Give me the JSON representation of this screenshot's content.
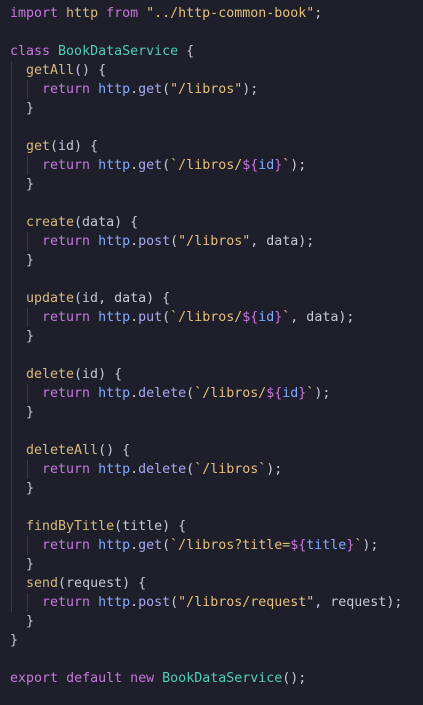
{
  "code": {
    "language": "javascript",
    "lines": [
      [
        {
          "t": "import",
          "c": "kw"
        },
        {
          "t": " http ",
          "c": "fnname"
        },
        {
          "t": "from",
          "c": "kw"
        },
        {
          "t": " ",
          "c": "punc"
        },
        {
          "t": "\"../http-common-book\"",
          "c": "str"
        },
        {
          "t": ";",
          "c": "punc"
        }
      ],
      [],
      [
        {
          "t": "class",
          "c": "kw"
        },
        {
          "t": " ",
          "c": "punc"
        },
        {
          "t": "BookDataService",
          "c": "cls"
        },
        {
          "t": " {",
          "c": "punc"
        }
      ],
      [
        {
          "t": "  getAll",
          "c": "fnname"
        },
        {
          "t": "() {",
          "c": "punc"
        }
      ],
      [
        {
          "t": "    ",
          "c": "punc"
        },
        {
          "t": "return",
          "c": "kw"
        },
        {
          "t": " http",
          "c": "var"
        },
        {
          "t": ".",
          "c": "punc"
        },
        {
          "t": "get",
          "c": "fn"
        },
        {
          "t": "(",
          "c": "punc"
        },
        {
          "t": "\"/libros\"",
          "c": "str"
        },
        {
          "t": ");",
          "c": "punc"
        }
      ],
      [
        {
          "t": "  }",
          "c": "punc"
        }
      ],
      [],
      [
        {
          "t": "  get",
          "c": "fnname"
        },
        {
          "t": "(id) {",
          "c": "punc"
        }
      ],
      [
        {
          "t": "    ",
          "c": "punc"
        },
        {
          "t": "return",
          "c": "kw"
        },
        {
          "t": " http",
          "c": "var"
        },
        {
          "t": ".",
          "c": "punc"
        },
        {
          "t": "get",
          "c": "fn"
        },
        {
          "t": "(",
          "c": "punc"
        },
        {
          "t": "`/libros/",
          "c": "tpl"
        },
        {
          "t": "${",
          "c": "kw"
        },
        {
          "t": "id",
          "c": "var"
        },
        {
          "t": "}",
          "c": "kw"
        },
        {
          "t": "`",
          "c": "tpl"
        },
        {
          "t": ");",
          "c": "punc"
        }
      ],
      [
        {
          "t": "  }",
          "c": "punc"
        }
      ],
      [],
      [
        {
          "t": "  create",
          "c": "fnname"
        },
        {
          "t": "(data) {",
          "c": "punc"
        }
      ],
      [
        {
          "t": "    ",
          "c": "punc"
        },
        {
          "t": "return",
          "c": "kw"
        },
        {
          "t": " http",
          "c": "var"
        },
        {
          "t": ".",
          "c": "punc"
        },
        {
          "t": "post",
          "c": "fn"
        },
        {
          "t": "(",
          "c": "punc"
        },
        {
          "t": "\"/libros\"",
          "c": "str"
        },
        {
          "t": ", data);",
          "c": "punc"
        }
      ],
      [
        {
          "t": "  }",
          "c": "punc"
        }
      ],
      [],
      [
        {
          "t": "  update",
          "c": "fnname"
        },
        {
          "t": "(id, data) {",
          "c": "punc"
        }
      ],
      [
        {
          "t": "    ",
          "c": "punc"
        },
        {
          "t": "return",
          "c": "kw"
        },
        {
          "t": " http",
          "c": "var"
        },
        {
          "t": ".",
          "c": "punc"
        },
        {
          "t": "put",
          "c": "fn"
        },
        {
          "t": "(",
          "c": "punc"
        },
        {
          "t": "`/libros/",
          "c": "tpl"
        },
        {
          "t": "${",
          "c": "kw"
        },
        {
          "t": "id",
          "c": "var"
        },
        {
          "t": "}",
          "c": "kw"
        },
        {
          "t": "`",
          "c": "tpl"
        },
        {
          "t": ", data);",
          "c": "punc"
        }
      ],
      [
        {
          "t": "  }",
          "c": "punc"
        }
      ],
      [],
      [
        {
          "t": "  delete",
          "c": "fnname"
        },
        {
          "t": "(id) {",
          "c": "punc"
        }
      ],
      [
        {
          "t": "    ",
          "c": "punc"
        },
        {
          "t": "return",
          "c": "kw"
        },
        {
          "t": " http",
          "c": "var"
        },
        {
          "t": ".",
          "c": "punc"
        },
        {
          "t": "delete",
          "c": "fn"
        },
        {
          "t": "(",
          "c": "punc"
        },
        {
          "t": "`/libros/",
          "c": "tpl"
        },
        {
          "t": "${",
          "c": "kw"
        },
        {
          "t": "id",
          "c": "var"
        },
        {
          "t": "}",
          "c": "kw"
        },
        {
          "t": "`",
          "c": "tpl"
        },
        {
          "t": ");",
          "c": "punc"
        }
      ],
      [
        {
          "t": "  }",
          "c": "punc"
        }
      ],
      [],
      [
        {
          "t": "  deleteAll",
          "c": "fnname"
        },
        {
          "t": "() {",
          "c": "punc"
        }
      ],
      [
        {
          "t": "    ",
          "c": "punc"
        },
        {
          "t": "return",
          "c": "kw"
        },
        {
          "t": " http",
          "c": "var"
        },
        {
          "t": ".",
          "c": "punc"
        },
        {
          "t": "delete",
          "c": "fn"
        },
        {
          "t": "(",
          "c": "punc"
        },
        {
          "t": "`/libros`",
          "c": "tpl"
        },
        {
          "t": ");",
          "c": "punc"
        }
      ],
      [
        {
          "t": "  }",
          "c": "punc"
        }
      ],
      [],
      [
        {
          "t": "  findByTitle",
          "c": "fnname"
        },
        {
          "t": "(title) {",
          "c": "punc"
        }
      ],
      [
        {
          "t": "    ",
          "c": "punc"
        },
        {
          "t": "return",
          "c": "kw"
        },
        {
          "t": " http",
          "c": "var"
        },
        {
          "t": ".",
          "c": "punc"
        },
        {
          "t": "get",
          "c": "fn"
        },
        {
          "t": "(",
          "c": "punc"
        },
        {
          "t": "`/libros?title=",
          "c": "tpl"
        },
        {
          "t": "${",
          "c": "kw"
        },
        {
          "t": "title",
          "c": "var"
        },
        {
          "t": "}",
          "c": "kw"
        },
        {
          "t": "`",
          "c": "tpl"
        },
        {
          "t": ");",
          "c": "punc"
        }
      ],
      [
        {
          "t": "  }",
          "c": "punc"
        }
      ],
      [
        {
          "t": "  send",
          "c": "fnname"
        },
        {
          "t": "(request) {",
          "c": "punc"
        }
      ],
      [
        {
          "t": "    ",
          "c": "punc"
        },
        {
          "t": "return",
          "c": "kw"
        },
        {
          "t": " http",
          "c": "var"
        },
        {
          "t": ".",
          "c": "punc"
        },
        {
          "t": "post",
          "c": "fn"
        },
        {
          "t": "(",
          "c": "punc"
        },
        {
          "t": "\"/libros/request\"",
          "c": "str"
        },
        {
          "t": ", request);",
          "c": "punc"
        }
      ],
      [
        {
          "t": "  }",
          "c": "punc"
        }
      ],
      [
        {
          "t": "}",
          "c": "punc"
        }
      ],
      [],
      [
        {
          "t": "export",
          "c": "kw"
        },
        {
          "t": " ",
          "c": "punc"
        },
        {
          "t": "default",
          "c": "kw"
        },
        {
          "t": " ",
          "c": "punc"
        },
        {
          "t": "new",
          "c": "kw"
        },
        {
          "t": " ",
          "c": "punc"
        },
        {
          "t": "BookDataService",
          "c": "cls"
        },
        {
          "t": "();",
          "c": "punc"
        }
      ]
    ]
  },
  "colors": {
    "background": "#1f1e2b",
    "keyword": "#c678dd",
    "class_name": "#4fd0b8",
    "method": "#a6a9f0",
    "string": "#e5c07b",
    "variable": "#82aaff",
    "punctuation": "#c6c9d8",
    "indent_guide": "#3a3a4c"
  }
}
